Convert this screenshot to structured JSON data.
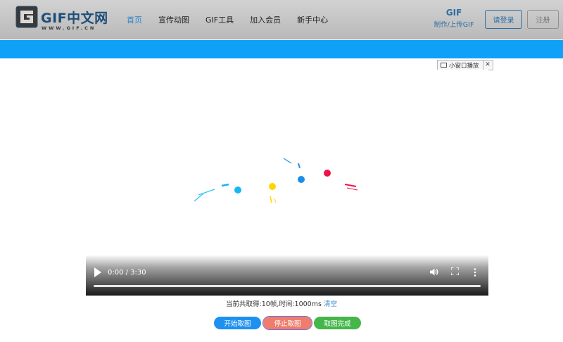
{
  "header": {
    "logo_text": "GIF中文网",
    "logo_sub": "WWW.GIF.CN",
    "nav": [
      {
        "label": "首页",
        "active": true
      },
      {
        "label": "宣传动图",
        "active": false
      },
      {
        "label": "GIF工具",
        "active": false
      },
      {
        "label": "加入会员",
        "active": false
      },
      {
        "label": "新手中心",
        "active": false
      }
    ],
    "upload_title": "GIF",
    "upload_sub": "制作/上传GIF",
    "login_label": "请登录",
    "register_label": "注册"
  },
  "mini_window": {
    "label": "小窗口播放",
    "icon": "tv-icon",
    "close_icon": "close-icon"
  },
  "video": {
    "time_display": "0:00 / 3:30",
    "progress": 0,
    "icons": [
      "play-icon",
      "volume-icon",
      "fullscreen-icon",
      "more-vert-icon"
    ]
  },
  "status": {
    "text": "当前共取得:10帧,时间:1000ms",
    "clear_label": "清空"
  },
  "actions": {
    "start_label": "开始取图",
    "stop_label": "停止取图",
    "done_label": "取图完成"
  },
  "colors": {
    "band": "#0fa1f7",
    "start": "#1e90f0",
    "stop": "#ef7d6d",
    "done": "#45b64a",
    "link": "#2f86c8"
  }
}
